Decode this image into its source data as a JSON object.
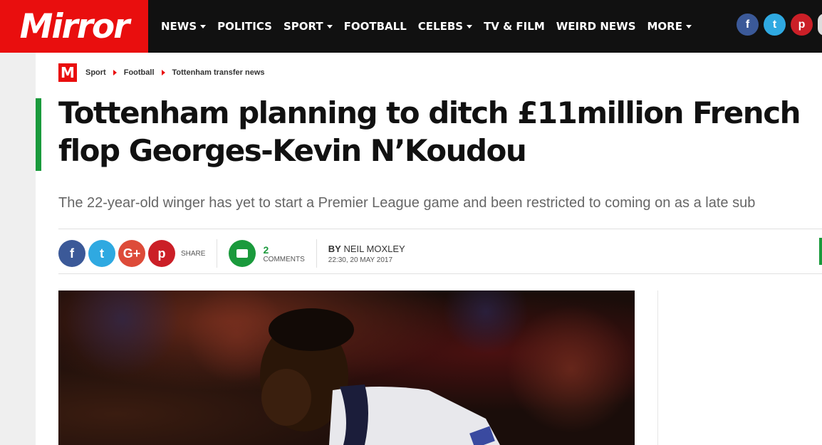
{
  "brand": {
    "name": "Mirror",
    "mark": "M",
    "color": "#e90e0e"
  },
  "nav": {
    "items": [
      {
        "label": "NEWS",
        "dropdown": true
      },
      {
        "label": "POLITICS",
        "dropdown": false
      },
      {
        "label": "SPORT",
        "dropdown": true
      },
      {
        "label": "FOOTBALL",
        "dropdown": false
      },
      {
        "label": "CELEBS",
        "dropdown": true
      },
      {
        "label": "TV & FILM",
        "dropdown": false
      },
      {
        "label": "WEIRD NEWS",
        "dropdown": false
      },
      {
        "label": "MORE",
        "dropdown": true
      }
    ],
    "social": [
      {
        "icon": "facebook-icon",
        "glyph": "f",
        "color": "#3b5998"
      },
      {
        "icon": "twitter-icon",
        "glyph": "t",
        "color": "#2fa9e1"
      },
      {
        "icon": "pinterest-icon",
        "glyph": "p",
        "color": "#cb1f27"
      }
    ]
  },
  "breadcrumb": [
    "Sport",
    "Football",
    "Tottenham transfer news"
  ],
  "article": {
    "headline": "Tottenham planning to ditch £11million French flop Georges-Kevin N’Koudou",
    "standfirst": "The 22-year-old winger has yet to start a Premier League game and been restricted to coming on as a late sub",
    "share_label": "SHARE",
    "share": [
      {
        "icon": "facebook-icon",
        "glyph": "f"
      },
      {
        "icon": "twitter-icon",
        "glyph": "t"
      },
      {
        "icon": "google-plus-icon",
        "glyph": "G+"
      },
      {
        "icon": "pinterest-icon",
        "glyph": "p"
      }
    ],
    "comments": {
      "count": "2",
      "label": "COMMENTS"
    },
    "author_prefix": "BY",
    "author": "NEIL MOXLEY",
    "date": "22:30, 20 MAY 2017"
  },
  "colors": {
    "accent_green": "#1a9a3c",
    "nav_bg": "#111111"
  }
}
